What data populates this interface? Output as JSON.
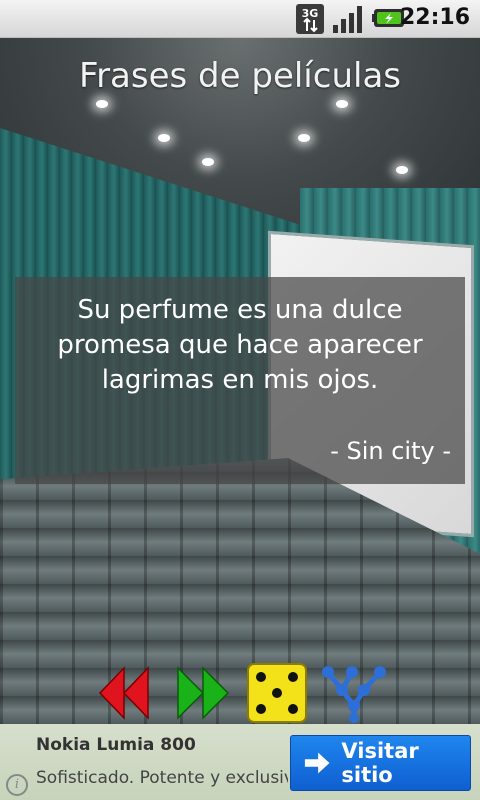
{
  "status_bar": {
    "network": "3G",
    "time": "22:16"
  },
  "app": {
    "title": "Frases de películas"
  },
  "quote": {
    "lines": [
      "Su perfume es una dulce",
      "promesa que hace aparecer",
      "lagrimas en mis ojos."
    ],
    "author": "- Sin city -"
  },
  "controls": {
    "icons": [
      "rewind-icon",
      "fast-forward-icon",
      "dice-icon",
      "share-icon"
    ],
    "colors": {
      "rewind": "#e0141e",
      "forward": "#19b219",
      "dice": "#f3e21a",
      "share": "#2d6fd6"
    }
  },
  "ad": {
    "title": "Nokia Lumia 800",
    "description": "Sofisticado. Potente y exclusivo",
    "cta_label": "Visitar sitio",
    "info_icon": "i"
  }
}
